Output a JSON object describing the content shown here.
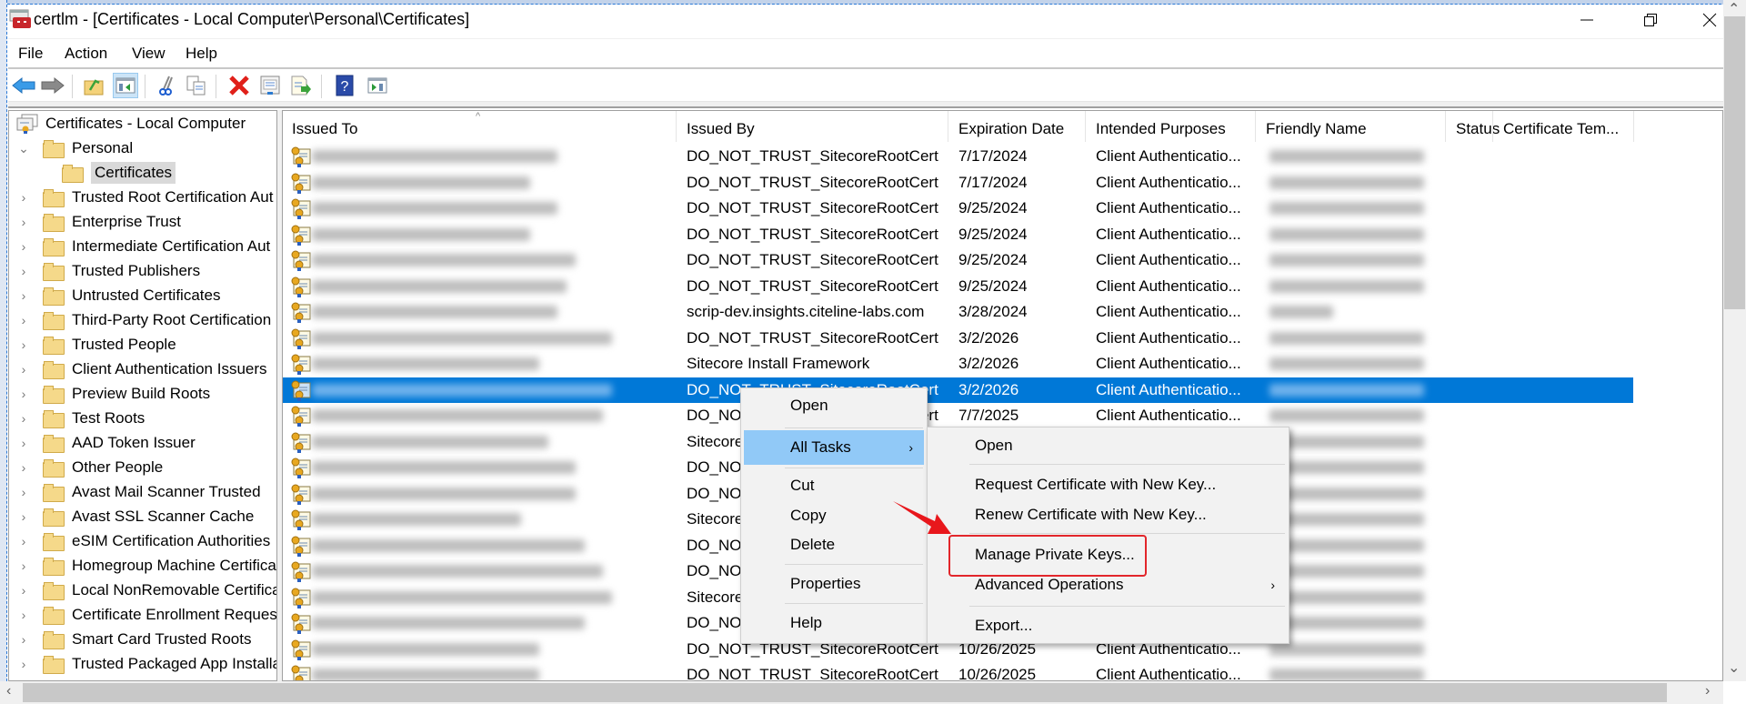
{
  "window": {
    "title": "certlm - [Certificates - Local Computer\\Personal\\Certificates]",
    "app_icon": "mmc-toolbox-icon",
    "minimize_label": "—",
    "restore_label": "❐",
    "close_label": "✕"
  },
  "menubar": [
    "File",
    "Action",
    "View",
    "Help"
  ],
  "toolbar": [
    {
      "name": "back",
      "icon": "back-arrow-icon"
    },
    {
      "name": "forward",
      "icon": "forward-arrow-icon"
    },
    {
      "name": "up-one-level",
      "icon": "folder-up-icon"
    },
    {
      "name": "show-hide-console-tree",
      "icon": "console-tree-icon",
      "active": true
    },
    {
      "name": "cut",
      "icon": "scissors-icon"
    },
    {
      "name": "copy",
      "icon": "copy-icon"
    },
    {
      "name": "delete",
      "icon": "delete-x-icon"
    },
    {
      "name": "properties",
      "icon": "properties-icon"
    },
    {
      "name": "export-list",
      "icon": "export-list-icon"
    },
    {
      "name": "help",
      "icon": "help-icon"
    },
    {
      "name": "show-hide-action-pane",
      "icon": "action-pane-icon"
    }
  ],
  "tree": {
    "root": "Certificates - Local Computer",
    "items": [
      {
        "label": "Personal",
        "expanded": true,
        "level": 1
      },
      {
        "label": "Certificates",
        "selected": true,
        "level": 2
      },
      {
        "label": "Trusted Root Certification Aut",
        "level": 1
      },
      {
        "label": "Enterprise Trust",
        "level": 1
      },
      {
        "label": "Intermediate Certification Aut",
        "level": 1
      },
      {
        "label": "Trusted Publishers",
        "level": 1
      },
      {
        "label": "Untrusted Certificates",
        "level": 1
      },
      {
        "label": "Third-Party Root Certification",
        "level": 1
      },
      {
        "label": "Trusted People",
        "level": 1
      },
      {
        "label": "Client Authentication Issuers",
        "level": 1
      },
      {
        "label": "Preview Build Roots",
        "level": 1
      },
      {
        "label": "Test Roots",
        "level": 1
      },
      {
        "label": "AAD Token Issuer",
        "level": 1
      },
      {
        "label": "Other People",
        "level": 1
      },
      {
        "label": "Avast Mail Scanner Trusted",
        "level": 1
      },
      {
        "label": "Avast SSL Scanner Cache",
        "level": 1
      },
      {
        "label": "eSIM Certification Authorities",
        "level": 1
      },
      {
        "label": "Homegroup Machine Certifica",
        "level": 1
      },
      {
        "label": "Local NonRemovable Certifica",
        "level": 1
      },
      {
        "label": "Certificate Enrollment Reques",
        "level": 1
      },
      {
        "label": "Smart Card Trusted Roots",
        "level": 1
      },
      {
        "label": "Trusted Packaged App Installa",
        "level": 1
      }
    ]
  },
  "list": {
    "columns": [
      "Issued To",
      "Issued By",
      "Expiration Date",
      "Intended Purposes",
      "Friendly Name",
      "Status",
      "Certificate Tem..."
    ],
    "rows": [
      {
        "issued_by": "DO_NOT_TRUST_SitecoreRootCert",
        "expiration": "7/17/2024",
        "purposes": "Client Authenticatio..."
      },
      {
        "issued_by": "DO_NOT_TRUST_SitecoreRootCert",
        "expiration": "7/17/2024",
        "purposes": "Client Authenticatio..."
      },
      {
        "issued_by": "DO_NOT_TRUST_SitecoreRootCert",
        "expiration": "9/25/2024",
        "purposes": "Client Authenticatio..."
      },
      {
        "issued_by": "DO_NOT_TRUST_SitecoreRootCert",
        "expiration": "9/25/2024",
        "purposes": "Client Authenticatio..."
      },
      {
        "issued_by": "DO_NOT_TRUST_SitecoreRootCert",
        "expiration": "9/25/2024",
        "purposes": "Client Authenticatio..."
      },
      {
        "issued_by": "DO_NOT_TRUST_SitecoreRootCert",
        "expiration": "9/25/2024",
        "purposes": "Client Authenticatio..."
      },
      {
        "issued_by": "scrip-dev.insights.citeline-labs.com",
        "expiration": "3/28/2024",
        "purposes": "Client Authenticatio..."
      },
      {
        "issued_by": "DO_NOT_TRUST_SitecoreRootCert",
        "expiration": "3/2/2026",
        "purposes": "Client Authenticatio..."
      },
      {
        "issued_by": "Sitecore Install Framework",
        "expiration": "3/2/2026",
        "purposes": "Client Authenticatio..."
      },
      {
        "issued_by": "DO_NOT_TRUST_SitecoreRootCert",
        "expiration": "3/2/2026",
        "purposes": "Client Authenticatio...",
        "selected": true
      },
      {
        "issued_by": "DO_NOT_TRUST_SitecoreRootCert",
        "expiration": "7/7/2025",
        "purposes": "Client Authenticatio..."
      },
      {
        "issued_by": "Sitecore Install Framework",
        "expiration": "",
        "purposes": ""
      },
      {
        "issued_by": "DO_NOT_TRUST_SitecoreRootCert",
        "expiration": "",
        "purposes": ""
      },
      {
        "issued_by": "DO_NOT_TRUST_SitecoreRootCert",
        "expiration": "",
        "purposes": ""
      },
      {
        "issued_by": "Sitecore Install Framework",
        "expiration": "",
        "purposes": ""
      },
      {
        "issued_by": "DO_NOT_TRUST_SitecoreRootCert",
        "expiration": "",
        "purposes": ""
      },
      {
        "issued_by": "DO_NOT_TRUST_SitecoreRootCert",
        "expiration": "",
        "purposes": ""
      },
      {
        "issued_by": "Sitecore Install Framework",
        "expiration": "",
        "purposes": ""
      },
      {
        "issued_by": "DO_NOT_TRUST_SitecoreRootCert",
        "expiration": "",
        "purposes": ""
      },
      {
        "issued_by": "DO_NOT_TRUST_SitecoreRootCert",
        "expiration": "10/26/2025",
        "purposes": "Client Authenticatio..."
      },
      {
        "issued_by": "DO_NOT_TRUST_SitecoreRootCert",
        "expiration": "10/26/2025",
        "purposes": "Client Authenticatio..."
      }
    ]
  },
  "context_menu": {
    "items": [
      "Open",
      "All Tasks",
      "Cut",
      "Copy",
      "Delete",
      "Properties",
      "Help"
    ],
    "highlighted": "All Tasks"
  },
  "submenu": {
    "items": [
      "Open",
      "Request Certificate with New Key...",
      "Renew Certificate with New Key...",
      "Manage Private Keys...",
      "Advanced Operations",
      "Export..."
    ],
    "callout": "Manage Private Keys..."
  },
  "colors": {
    "selection": "#0078d7",
    "menu_highlight": "#91c9f7",
    "callout": "#e2262b"
  }
}
